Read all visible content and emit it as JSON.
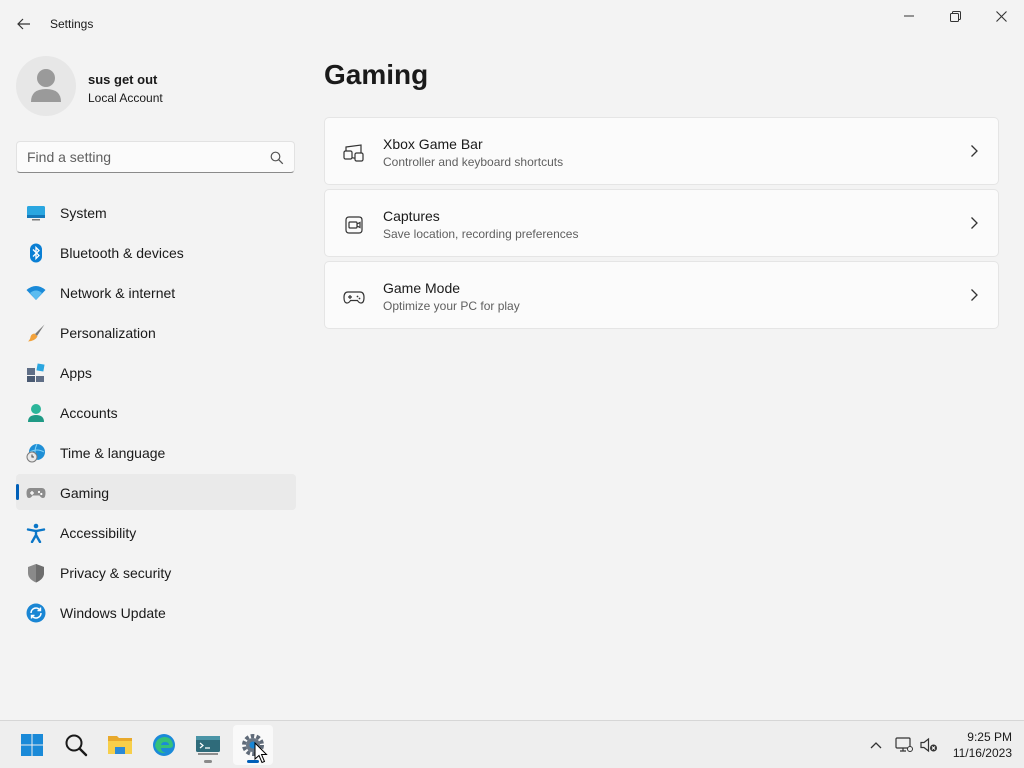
{
  "window": {
    "title": "Settings",
    "back_icon": "back-arrow-icon",
    "controls": [
      "minimize-icon",
      "maximize-icon",
      "close-icon"
    ]
  },
  "profile": {
    "name": "sus get out",
    "account_type": "Local Account",
    "avatar_icon": "person-icon"
  },
  "search": {
    "placeholder": "Find a setting",
    "value": "",
    "icon": "search-icon"
  },
  "sidebar": {
    "items": [
      {
        "label": "System",
        "icon": "system-icon",
        "active": false
      },
      {
        "label": "Bluetooth & devices",
        "icon": "bluetooth-icon",
        "active": false
      },
      {
        "label": "Network & internet",
        "icon": "wifi-icon",
        "active": false
      },
      {
        "label": "Personalization",
        "icon": "brush-icon",
        "active": false
      },
      {
        "label": "Apps",
        "icon": "apps-icon",
        "active": false
      },
      {
        "label": "Accounts",
        "icon": "accounts-icon",
        "active": false
      },
      {
        "label": "Time & language",
        "icon": "time-language-icon",
        "active": false
      },
      {
        "label": "Gaming",
        "icon": "gamepad-icon",
        "active": true
      },
      {
        "label": "Accessibility",
        "icon": "accessibility-icon",
        "active": false
      },
      {
        "label": "Privacy & security",
        "icon": "shield-icon",
        "active": false
      },
      {
        "label": "Windows Update",
        "icon": "update-icon",
        "active": false
      }
    ]
  },
  "main": {
    "title": "Gaming",
    "cards": [
      {
        "title": "Xbox Game Bar",
        "subtitle": "Controller and keyboard shortcuts",
        "icon": "game-bar-icon"
      },
      {
        "title": "Captures",
        "subtitle": "Save location, recording preferences",
        "icon": "captures-icon"
      },
      {
        "title": "Game Mode",
        "subtitle": "Optimize your PC for play",
        "icon": "game-mode-icon"
      }
    ]
  },
  "taskbar": {
    "apps": [
      "windows-start-icon",
      "search-icon",
      "file-explorer-icon",
      "edge-icon",
      "terminal-icon",
      "settings-icon"
    ],
    "tray": [
      "chevron-up-icon",
      "network-icon",
      "speaker-muted-icon"
    ],
    "time": "9:25 PM",
    "date": "11/16/2023"
  },
  "colors": {
    "accent": "#005fb8",
    "background": "#f3f3f3",
    "card": "#fbfbfb"
  }
}
